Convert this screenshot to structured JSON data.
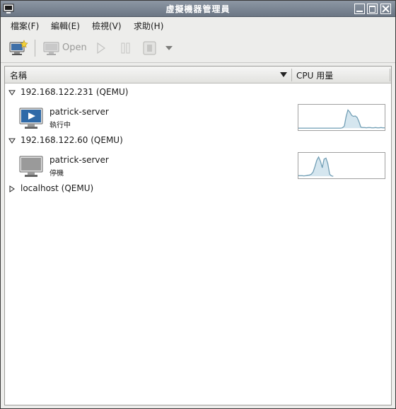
{
  "window": {
    "title": "虛擬機器管理員"
  },
  "menubar": {
    "items": [
      {
        "label": "檔案(F)"
      },
      {
        "label": "編輯(E)"
      },
      {
        "label": "檢視(V)"
      },
      {
        "label": "求助(H)"
      }
    ]
  },
  "toolbar": {
    "new_icon": "new-vm-icon",
    "open_label": "Open",
    "run_icon": "play-icon",
    "pause_icon": "pause-icon",
    "stop_icon": "shutdown-icon",
    "menu_icon": "dropdown-arrow-icon"
  },
  "list": {
    "columns": {
      "name": "名稱",
      "cpu": "CPU 用量"
    },
    "connections": [
      {
        "label": "192.168.122.231 (QEMU)",
        "expanded": true,
        "vms": [
          {
            "name": "patrick-server",
            "status": "執行中",
            "icon": "vm-running-icon",
            "cpu": [
              0,
              0,
              0,
              0,
              0,
              0,
              0,
              0,
              0,
              0,
              0,
              0,
              0,
              0,
              0,
              0,
              0,
              0,
              0,
              0,
              0,
              0,
              0,
              0,
              2,
              10,
              55,
              85,
              75,
              60,
              55,
              57,
              50,
              30,
              5,
              3,
              3,
              2,
              3,
              3,
              2,
              2,
              3,
              2,
              2,
              3,
              2,
              2
            ]
          }
        ]
      },
      {
        "label": "192.168.122.60 (QEMU)",
        "expanded": true,
        "vms": [
          {
            "name": "patrick-server",
            "status": "停機",
            "icon": "vm-stopped-icon",
            "cpu": [
              3,
              3,
              3,
              2,
              3,
              5,
              6,
              10,
              20,
              45,
              75,
              90,
              70,
              40,
              80,
              85,
              60,
              10,
              2,
              0,
              0,
              0,
              0,
              0,
              0,
              0,
              0,
              0,
              0,
              0,
              0,
              0,
              0,
              0,
              0,
              0,
              0,
              0,
              0,
              0,
              0,
              0,
              0,
              0,
              0,
              0,
              0,
              0
            ]
          }
        ]
      },
      {
        "label": "localhost (QEMU)",
        "expanded": false,
        "vms": []
      }
    ]
  },
  "colors": {
    "titlebar": "#7a8593",
    "spark_line": "#6f9db4",
    "spark_fill": "#d5e6ef"
  }
}
